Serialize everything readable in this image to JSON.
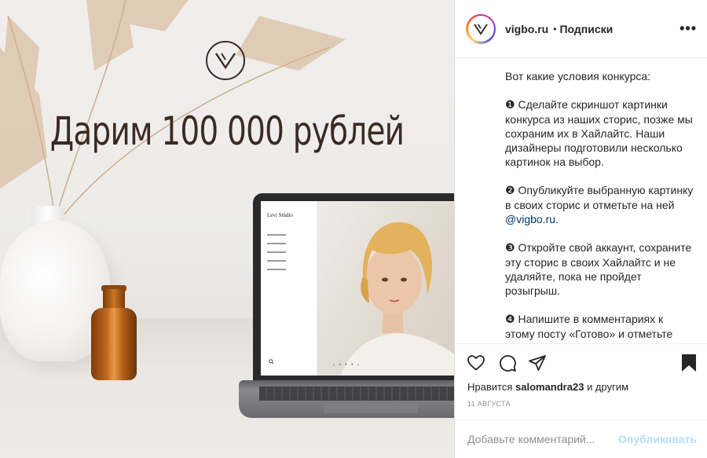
{
  "post_image": {
    "headline": "Дарим 100 000 рублей",
    "screen_brand": "Levi Stüdio",
    "screen_search_icon": "search-icon",
    "screen_dots": "‹ • • • ›"
  },
  "header": {
    "username": "vigbo.ru",
    "separator": "•",
    "follow_label": "Подписки",
    "more_label": "•••"
  },
  "caption": {
    "intro": "Вот какие условия конкурса:",
    "steps": [
      {
        "num": "❶",
        "text": "Сделайте скриншот картинки конкурса из наших сторис, позже мы сохраним их в Хайлайтс. Наши дизайнеры подготовили несколько картинок на выбор."
      },
      {
        "num": "❷",
        "text_before": "Опубликуйте выбранную картинку в своих сторис и отметьте на ней ",
        "mention": "@vigbo.ru",
        "text_after": "."
      },
      {
        "num": "❸",
        "text": "Откройте свой аккаунт, сохраните эту сторис в своих Хайлайтс и не удаляйте, пока не пройдет розыгрыш."
      },
      {
        "num": "❹",
        "text": "Напишите в комментариях к этому посту «Готово» и отметьте одного друга. Количество"
      }
    ]
  },
  "actions": {
    "like_icon": "heart-icon",
    "comment_icon": "comment-icon",
    "share_icon": "share-icon",
    "save_icon": "bookmark-icon"
  },
  "likes": {
    "prefix": "Нравится",
    "user": "salomandra23",
    "suffix": "и другим"
  },
  "date": "11 АВГУСТА",
  "comment": {
    "placeholder": "Добавьте комментарий...",
    "publish_label": "Опубликовать"
  },
  "colors": {
    "headline": "#3b2a23",
    "publish_disabled": "#b2dffc",
    "mention": "#00376b",
    "muted": "#8e8e8e"
  }
}
